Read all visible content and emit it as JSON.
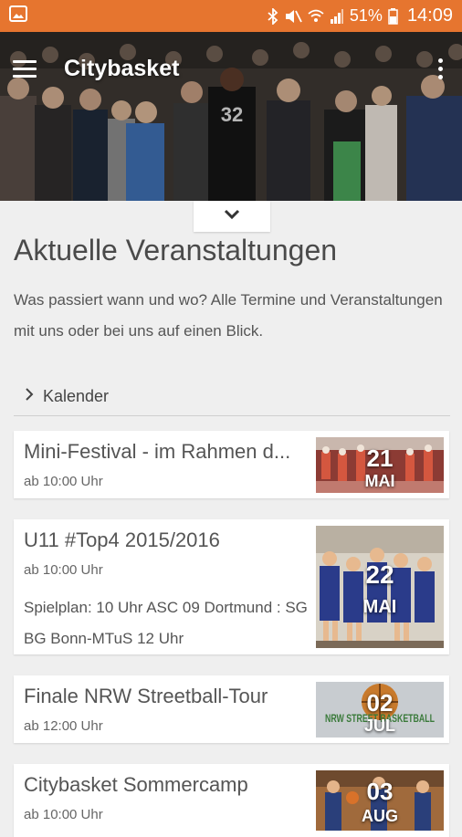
{
  "status_bar": {
    "battery_percent": "51%",
    "time": "14:09",
    "color": "#e6752f"
  },
  "toolbar": {
    "title": "Citybasket",
    "hero_jersey_number": "32"
  },
  "section": {
    "title": "Aktuelle Veranstaltungen",
    "description": "Was passiert wann und wo? Alle Termine und Veranstaltungen mit uns oder bei uns auf einen Blick.",
    "calendar_label": "Kalender"
  },
  "events": [
    {
      "title": "Mini-Festival - im Rahmen d...",
      "time": "ab 10:00 Uhr",
      "day": "21",
      "month": "MAI"
    },
    {
      "title": "U11 #Top4 2015/2016",
      "time": "ab 10:00 Uhr",
      "description": "Spielplan: 10 Uhr ASC 09 Dortmund : SG BG Bonn-MTuS 12 Uhr",
      "day": "22",
      "month": "MAI"
    },
    {
      "title": "Finale NRW Streetball-Tour",
      "time": "ab 12:00 Uhr",
      "day": "02",
      "month": "JUL",
      "thumb_text": "NRW STREET BASKETBALL"
    },
    {
      "title": "Citybasket Sommercamp",
      "time": "ab 10:00 Uhr",
      "day": "03",
      "month": "AUG"
    }
  ]
}
